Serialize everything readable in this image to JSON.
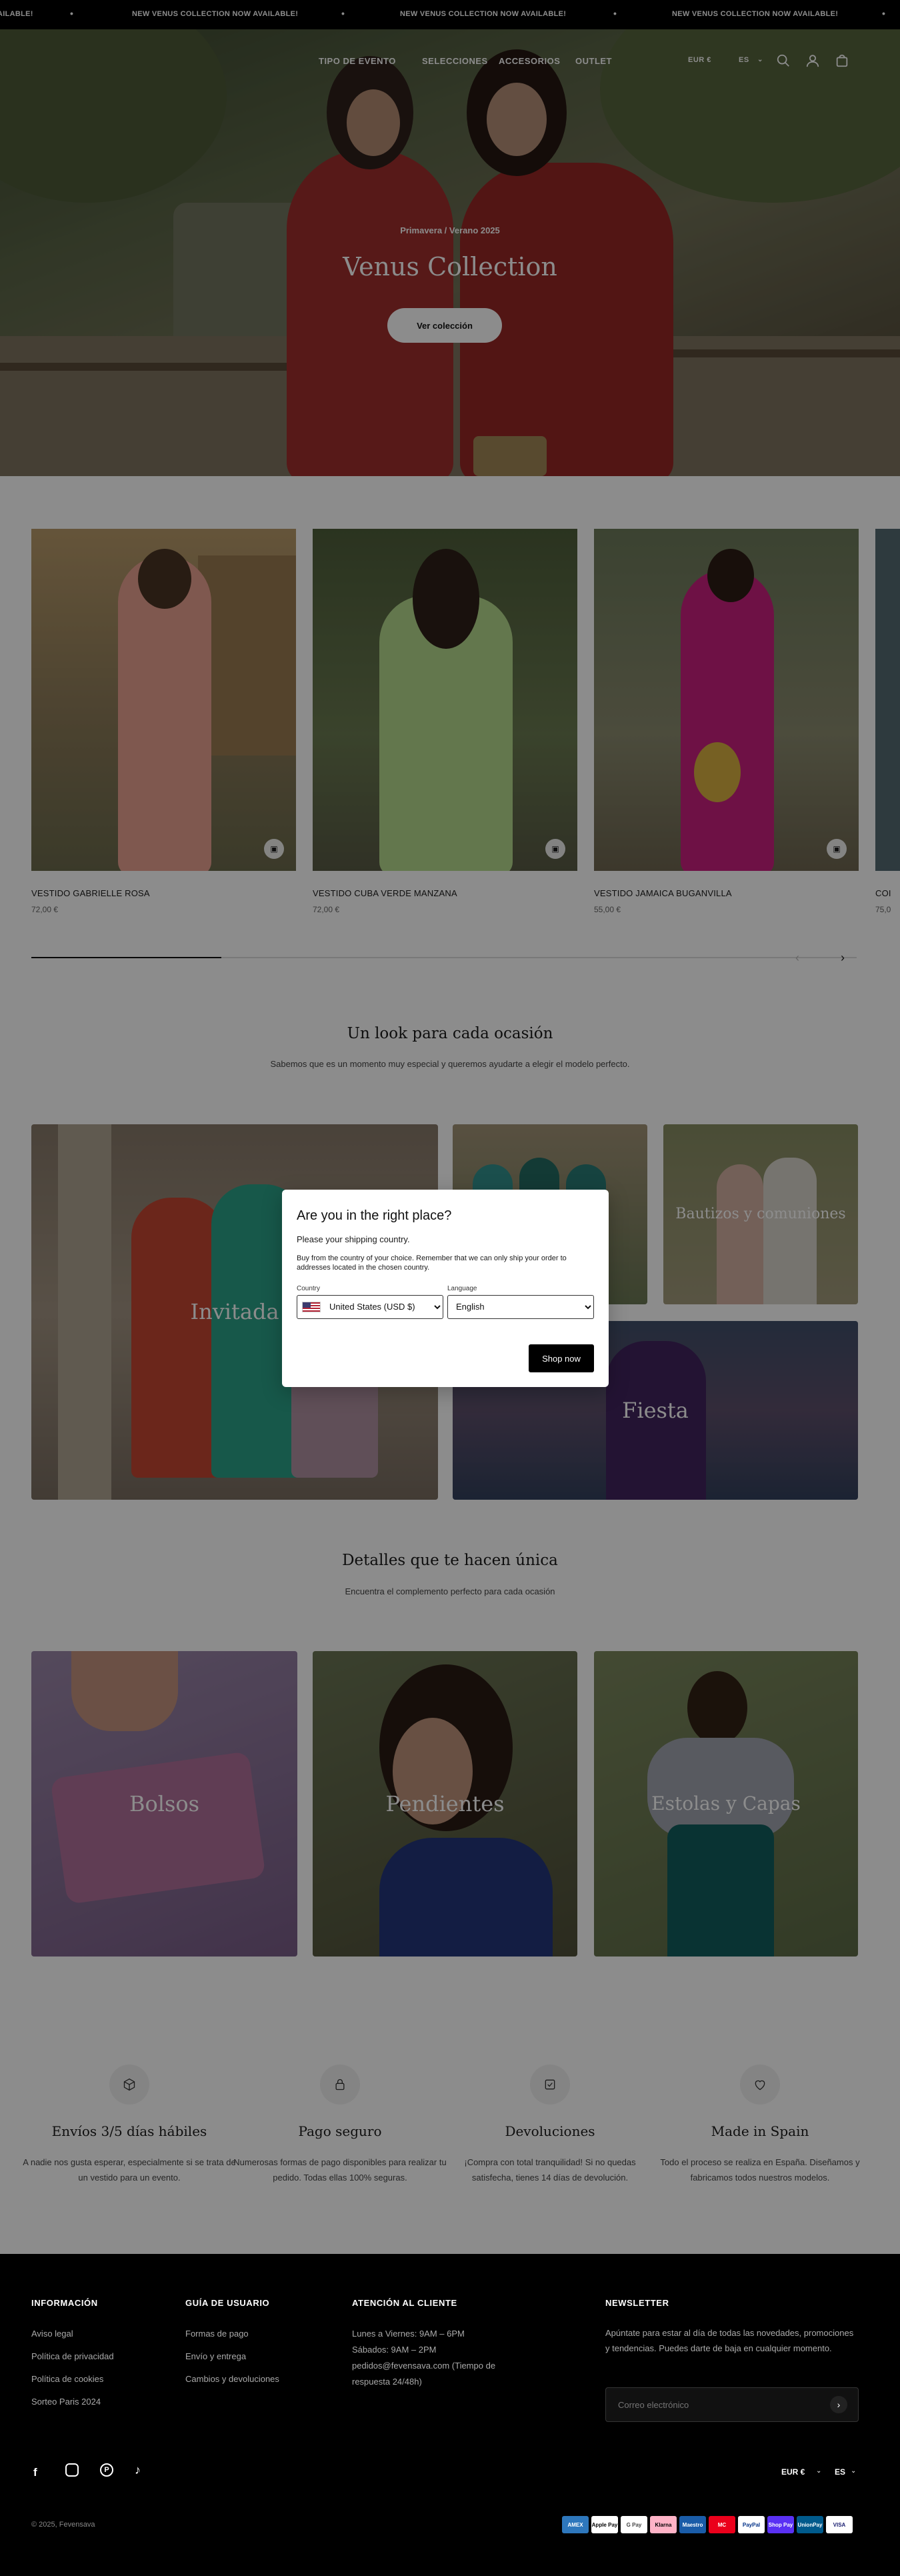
{
  "announcement": {
    "text": "NEW VENUS COLLECTION NOW AVAILABLE!",
    "partial_left": "AILABLE!"
  },
  "nav": {
    "links": [
      "TIPO DE EVENTO",
      "SELECCIONES",
      "ACCESORIOS",
      "OUTLET"
    ],
    "currency": "EUR €",
    "language": "ES"
  },
  "hero": {
    "subtitle": "Primavera / Verano 2025",
    "title": "Venus Collection",
    "button": "Ver colección"
  },
  "products": [
    {
      "name": "VESTIDO GABRIELLE ROSA",
      "price": "72,00 €"
    },
    {
      "name": "VESTIDO CUBA VERDE MANZANA",
      "price": "72,00 €"
    },
    {
      "name": "VESTIDO JAMAICA BUGANVILLA",
      "price": "55,00 €"
    },
    {
      "name": "COI",
      "price": "75,0"
    }
  ],
  "looks": {
    "title": "Un look para cada ocasión",
    "text": "Sabemos que es un momento muy especial y queremos ayudarte a elegir el modelo perfecto.",
    "tiles": [
      "Invitada",
      "Bautizos y comuniones",
      "Fiesta"
    ]
  },
  "details": {
    "title": "Detalles que te hacen única",
    "text": "Encuentra el complemento perfecto para cada ocasión",
    "tiles": [
      "Bolsos",
      "Pendientes",
      "Estolas y Capas"
    ]
  },
  "modal": {
    "title": "Are you in the right place?",
    "subtitle": "Please your shipping country.",
    "body": "Buy from the country of your choice. Remember that we can only ship your order to addresses located in the chosen country.",
    "country_label": "Country",
    "country_value": "United States (USD $)",
    "language_label": "Language",
    "language_value": "English",
    "button": "Shop now"
  },
  "features": [
    {
      "title": "Envíos 3/5 días hábiles",
      "text": "A nadie nos gusta esperar, especialmente si se trata de un vestido para un evento.",
      "icon": "box-icon"
    },
    {
      "title": "Pago seguro",
      "text": "Numerosas formas de pago disponibles para realizar tu pedido. Todas ellas 100% seguras.",
      "icon": "lock-icon"
    },
    {
      "title": "Devoluciones",
      "text": "¡Compra con total tranquilidad! Si no quedas satisfecha, tienes 14 días de devolución.",
      "icon": "return-icon"
    },
    {
      "title": "Made in Spain",
      "text": "Todo el proceso se realiza en España. Diseñamos y fabricamos todos nuestros modelos.",
      "icon": "heart-icon"
    }
  ],
  "footer": {
    "col1": {
      "title": "INFORMACIÓN",
      "links": [
        "Aviso legal",
        "Política de privacidad",
        "Política de cookies",
        "Sorteo Paris 2024"
      ]
    },
    "col2": {
      "title": "GUÍA DE USUARIO",
      "links": [
        "Formas de pago",
        "Envío y entrega",
        "Cambios y devoluciones"
      ]
    },
    "col3": {
      "title": "ATENCIÓN AL CLIENTE",
      "lines": [
        "Lunes a Viernes: 9AM – 6PM",
        "Sábados: 9AM – 2PM",
        "pedidos@fevensava.com (Tiempo de",
        "respuesta 24/48h)"
      ]
    },
    "newsletter": {
      "title": "NEWSLETTER",
      "text": "Apúntate para estar al día de todas las novedades, promociones y tendencias. Puedes darte de baja en cualquier momento.",
      "placeholder": "Correo electrónico"
    },
    "currency": "EUR €",
    "language": "ES",
    "copyright": "© 2025, Fevensava",
    "payments": [
      "AMEX",
      "Apple Pay",
      "G Pay",
      "Klarna",
      "Maestro",
      "MC",
      "PayPal",
      "Shop Pay",
      "UnionPay",
      "VISA"
    ]
  }
}
